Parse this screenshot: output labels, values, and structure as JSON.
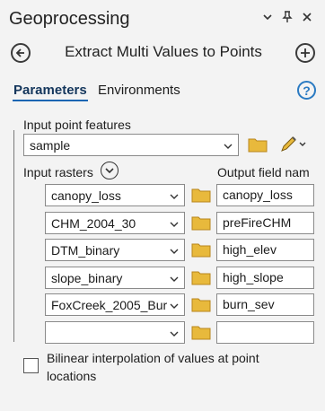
{
  "header": {
    "title": "Geoprocessing"
  },
  "tool": {
    "title": "Extract Multi Values to Points"
  },
  "tabs": [
    {
      "label": "Parameters"
    },
    {
      "label": "Environments"
    }
  ],
  "help_icon": "?",
  "input_points": {
    "label": "Input point features",
    "value": "sample"
  },
  "rasters": {
    "label": "Input rasters",
    "output_label": "Output field nam",
    "rows": [
      {
        "raster": "canopy_loss",
        "field": "canopy_loss"
      },
      {
        "raster": "CHM_2004_30",
        "field": "preFireCHM"
      },
      {
        "raster": "DTM_binary",
        "field": "high_elev"
      },
      {
        "raster": "slope_binary",
        "field": "high_slope"
      },
      {
        "raster": "FoxCreek_2005_Bur",
        "field": "burn_sev"
      },
      {
        "raster": "",
        "field": ""
      }
    ]
  },
  "bilinear": {
    "label_line1": "Bilinear interpolation of values at point",
    "label_line2": "locations"
  },
  "colors": {
    "accent": "#1a66b3",
    "folder": "#e8b93c"
  }
}
